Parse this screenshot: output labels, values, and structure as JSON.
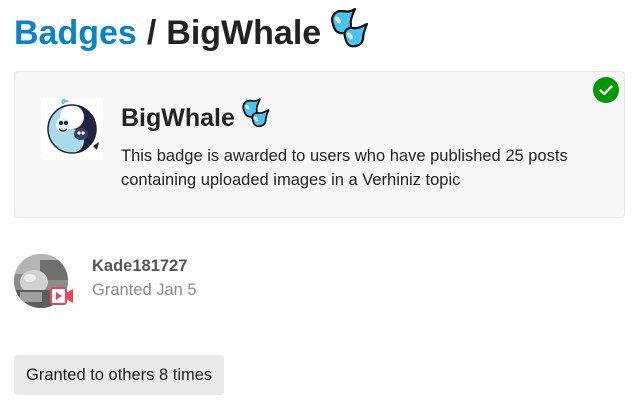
{
  "breadcrumb": {
    "parent_label": "Badges",
    "separator": "/",
    "current_label": "BigWhale"
  },
  "badge": {
    "name": "BigWhale",
    "description": "This badge is awarded to users who have published 25 posts containing uploaded images in a Verhiniz topic",
    "icon": "whale-badge-icon",
    "granted_status_icon": "checkmark-circle-icon"
  },
  "grant": {
    "username": "Kade181727",
    "granted_text": "Granted Jan 5",
    "avatar_overlay_icon": "video-camera-icon"
  },
  "others_button_label": "Granted to others 8 times",
  "colors": {
    "link_blue": "#0a84c6",
    "success_green": "#019901",
    "droplet_blue": "#4cc2f0",
    "card_background": "#f7f7f7",
    "button_background": "#e9e9e9"
  }
}
